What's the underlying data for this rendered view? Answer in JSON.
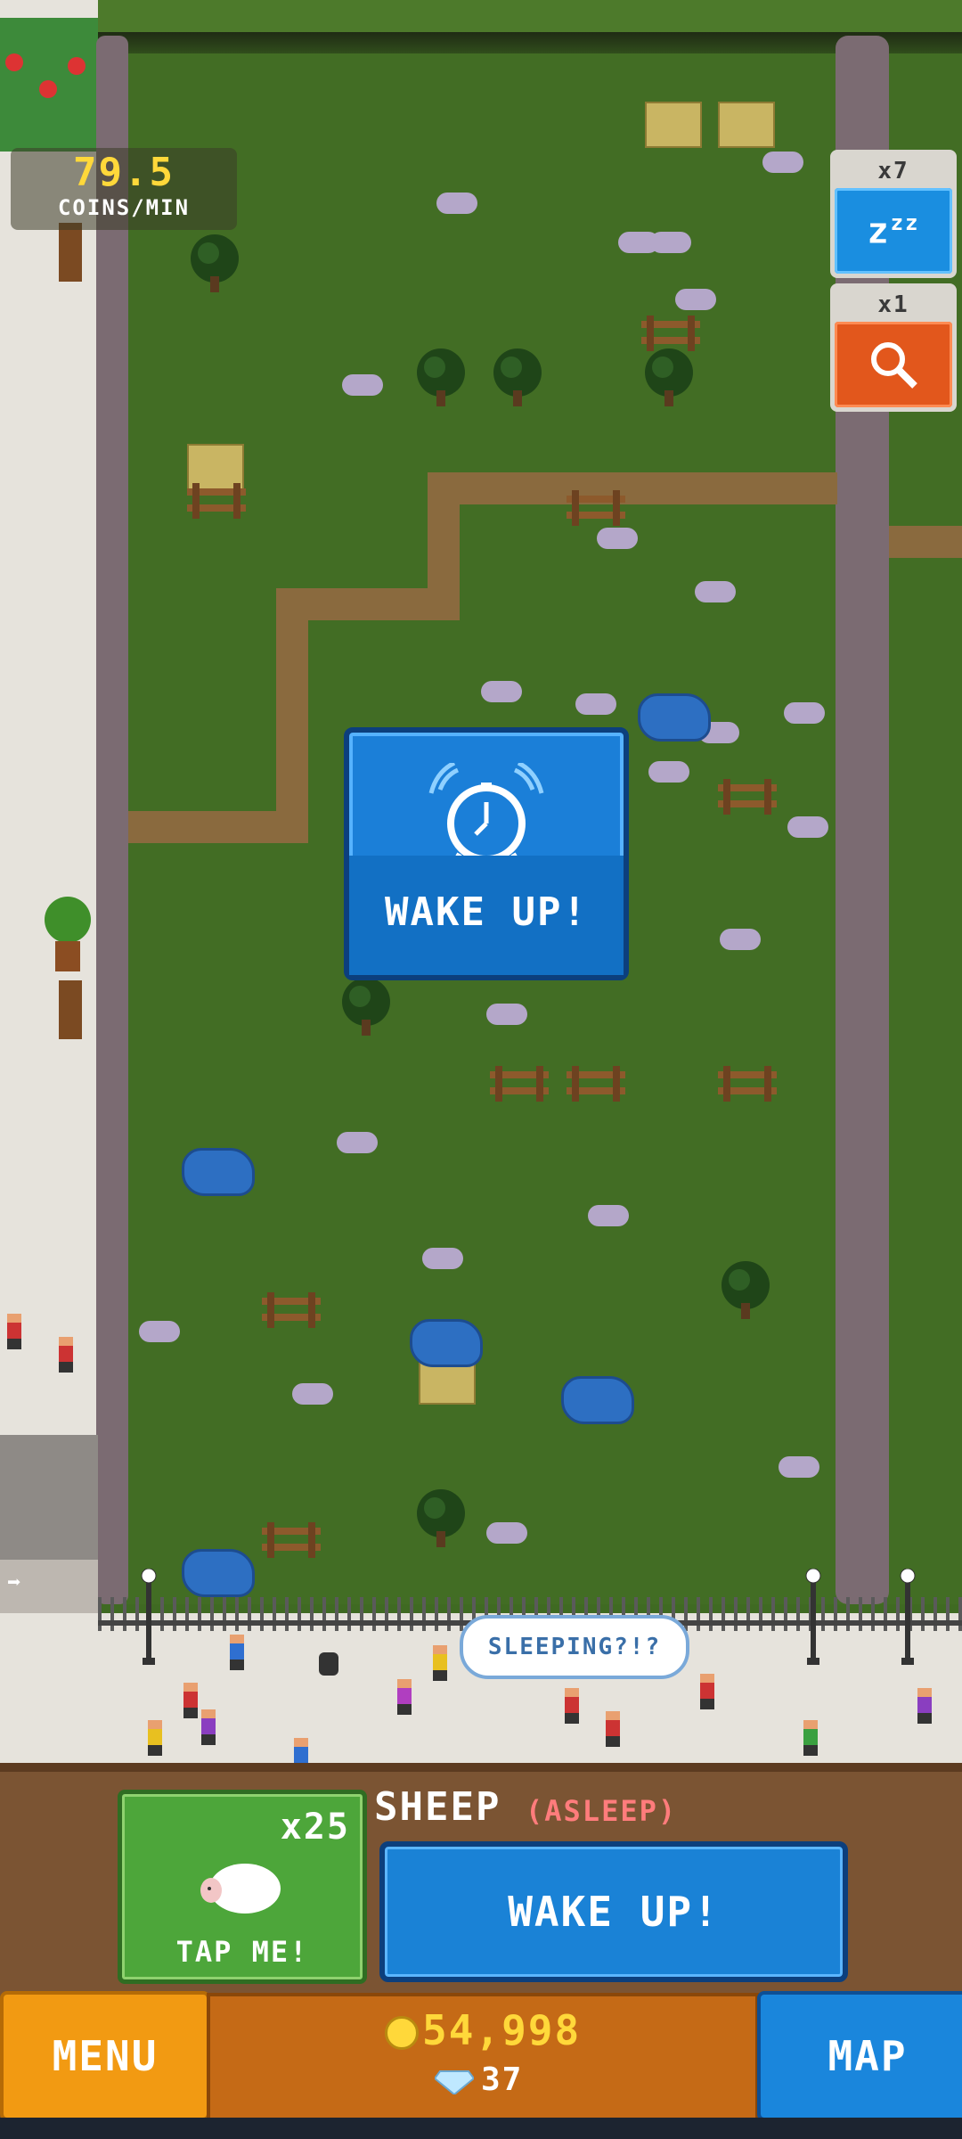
{
  "hud": {
    "coin_rate_value": "79.5",
    "coin_rate_unit": "COINS/MIN",
    "sleep_booster_count": "x7",
    "sleep_booster_icon": "zzz-icon",
    "search_booster_count": "x1",
    "search_booster_icon": "magnifier-icon"
  },
  "popup": {
    "icon": "alarm-clock-icon",
    "label": "WAKE UP!"
  },
  "speech_bubble": {
    "text": "SLEEPING?!?"
  },
  "animal_panel": {
    "count": "x25",
    "tap_label": "TAP ME!",
    "animal_name": "SHEEP",
    "animal_state": "(ASLEEP)",
    "wake_button_label": "WAKE UP!"
  },
  "bottom_bar": {
    "menu_label": "MENU",
    "map_label": "MAP",
    "coins": "54,998",
    "gems": "37",
    "coin_icon": "coin-icon",
    "gem_icon": "gem-icon"
  },
  "colors": {
    "grass": "#426d24",
    "blue_button": "#1a82d6",
    "orange_button": "#f29a12",
    "coin_yellow": "#ffd83a",
    "asleep_pink": "#ff7c7c"
  }
}
